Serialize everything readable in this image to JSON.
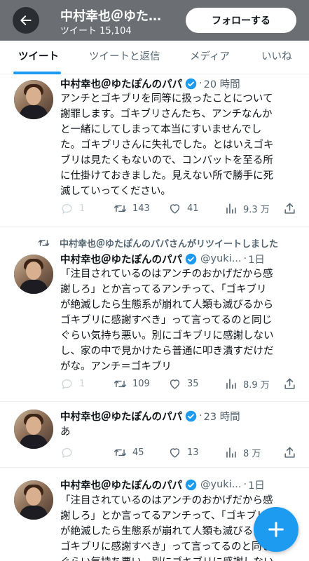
{
  "header": {
    "title": "中村幸也＠ゆた…",
    "subtitle": "ツイート 15,104",
    "follow_label": "フォローする"
  },
  "tabs": [
    {
      "label": "ツイート",
      "active": true
    },
    {
      "label": "ツイートと返信",
      "active": false
    },
    {
      "label": "メディア",
      "active": false
    },
    {
      "label": "いいね",
      "active": false
    }
  ],
  "retweet_banner": "中村幸也＠ゆたぽんのパパさんがリツイートしました",
  "tweets": [
    {
      "name": "中村幸也＠ゆたぽんのパパ",
      "handle": "",
      "sep": "·",
      "time": "20 時間",
      "text": "アンチとゴキブリを同等に扱ったことについて\n謝罪します。ゴキブリさんたち、アンチなんか\nと一緒にしてしまって本当にすいませんでし\nた。ゴキブリさんに失礼でした。とはいえゴキ\nブリは見たくもないので、コンバットを至る所\nに仕掛けておきました。見えない所で勝手に死\n滅していってください。",
      "replies": "1",
      "retweets": "143",
      "likes": "41",
      "views": "9.3 万"
    },
    {
      "name": "中村幸也＠ゆたぽんのパパ",
      "handle": "@yuki...",
      "sep": "·",
      "time": "1日",
      "text": "「注目されているのはアンチのおかげだから感\n謝しろ」とか言ってるアンチって、「ゴキブリ\nが絶滅したら生態系が崩れて人類も滅びるから\nゴキブリに感謝すべき」って言ってるのと同じ\nぐらい気持ち悪い。別にゴキブリに感謝しない\nし、家の中で見かけたら普通に叩き潰すだけだ\nがな。アンチ＝ゴキブリ",
      "replies": "1",
      "retweets": "109",
      "likes": "35",
      "views": "8.9 万"
    },
    {
      "name": "中村幸也＠ゆたぽんのパパ",
      "handle": "",
      "sep": "·",
      "time": "23 時間",
      "text": "あ",
      "replies": "",
      "retweets": "45",
      "likes": "13",
      "views": "8 万"
    },
    {
      "name": "中村幸也＠ゆたぽんのパパ",
      "handle": "@yuki...",
      "sep": "·",
      "time": "1日",
      "text": "「注目されているのはアンチのおかげだから感\n謝しろ」とか言ってるアンチって、「ゴキブリ\nが絶滅したら生態系が崩れて人類も滅びるから\nゴキブリに感謝すべき」って言ってるのと同じ\nぐらい気持ち悪い。別にゴキブリに感謝しない"
    }
  ],
  "colors": {
    "accent": "#1d9bf0",
    "header_bg": "#6b6e72",
    "muted": "#536471"
  }
}
